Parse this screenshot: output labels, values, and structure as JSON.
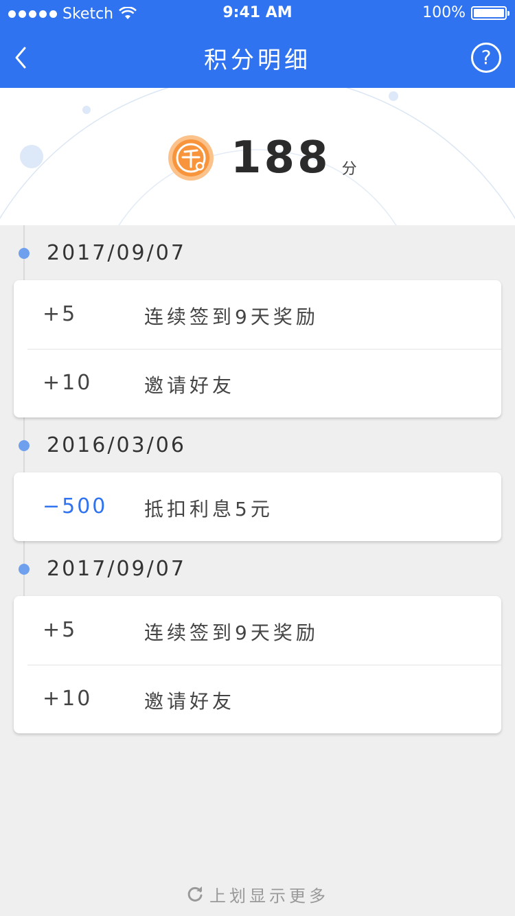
{
  "status_bar": {
    "carrier": "Sketch",
    "time": "9:41 AM",
    "battery": "100%"
  },
  "nav": {
    "title": "积分明细",
    "back_icon": "chevron-left-icon",
    "help_icon": "question-circle-icon",
    "help_symbol": "?"
  },
  "summary": {
    "points": "188",
    "unit": "分",
    "coin_icon": "points-coin-icon"
  },
  "groups": [
    {
      "date": "2017/09/07",
      "entries": [
        {
          "points": "+5",
          "desc": "连续签到9天奖励"
        },
        {
          "points": "+10",
          "desc": "邀请好友"
        }
      ]
    },
    {
      "date": "2016/03/06",
      "entries": [
        {
          "points": "−500",
          "desc": "抵扣利息5元"
        }
      ]
    },
    {
      "date": "2017/09/07",
      "entries": [
        {
          "points": "+5",
          "desc": "连续签到9天奖励"
        },
        {
          "points": "+10",
          "desc": "邀请好友"
        }
      ]
    }
  ],
  "load_more": {
    "label": "上划显示更多",
    "icon": "refresh-icon"
  },
  "colors": {
    "accent": "#2f73f0",
    "negative": "#2f73f0",
    "coin": "#f7943c",
    "timeline_dot": "#6fa0ee",
    "background": "#efefef"
  }
}
